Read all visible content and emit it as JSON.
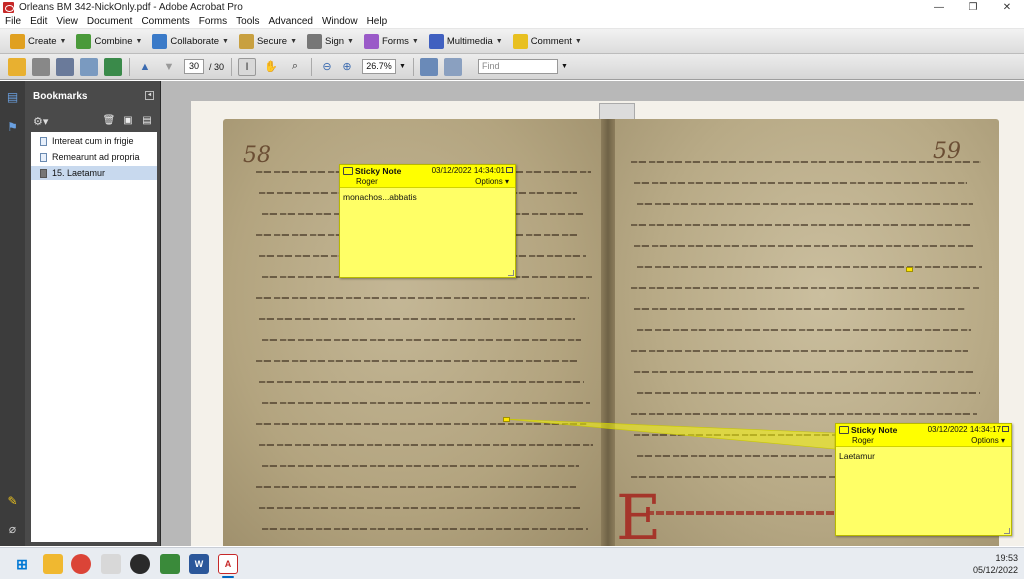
{
  "window": {
    "title": "Orleans BM 342-NickOnly.pdf - Adobe Acrobat Pro",
    "minimize": "—",
    "maximize": "❐",
    "close": "✕"
  },
  "menu": [
    "File",
    "Edit",
    "View",
    "Document",
    "Comments",
    "Forms",
    "Tools",
    "Advanced",
    "Window",
    "Help"
  ],
  "toolbar": {
    "create": "Create",
    "combine": "Combine",
    "collaborate": "Collaborate",
    "secure": "Secure",
    "sign": "Sign",
    "forms": "Forms",
    "multimedia": "Multimedia",
    "comment": "Comment"
  },
  "nav": {
    "current_page": "30",
    "total_pages": "/ 30",
    "zoom": "26.7%",
    "find_placeholder": "Find"
  },
  "bookmarks": {
    "title": "Bookmarks",
    "items": [
      {
        "label": "Intereat cum in frigie",
        "selected": false
      },
      {
        "label": "Remearunt ad propria",
        "selected": false
      },
      {
        "label": "15. Laetamur",
        "selected": true
      }
    ]
  },
  "document": {
    "folio_left": "58",
    "folio_right": "59"
  },
  "sticky_notes": [
    {
      "title": "Sticky Note",
      "date": "03/12/2022 14:34:01",
      "author": "Roger",
      "options": "Options",
      "text": "monachos...abbatis"
    },
    {
      "title": "Sticky Note",
      "date": "03/12/2022 14:34:17",
      "author": "Roger",
      "options": "Options",
      "text": "Laetamur"
    }
  ],
  "taskbar": {
    "time": "19:53",
    "date": "05/12/2022"
  },
  "colors": {
    "sticky_header": "#ffff00",
    "sticky_body": "#ffff66",
    "panel_dark": "#4a4a4a",
    "selected_bookmark": "#c8d9ee"
  }
}
